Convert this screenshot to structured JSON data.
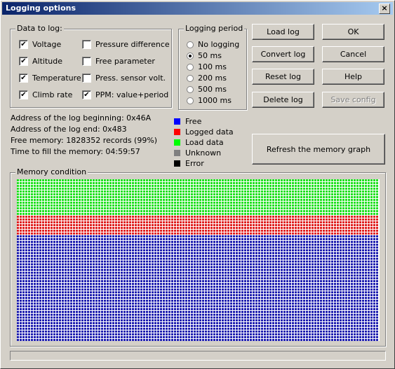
{
  "window": {
    "title": "Logging options",
    "close": "×"
  },
  "data_to_log": {
    "title": "Data to log:",
    "items": [
      {
        "label": "Voltage",
        "checked": true
      },
      {
        "label": "Altitude",
        "checked": true
      },
      {
        "label": "Temperature",
        "checked": true
      },
      {
        "label": "Climb rate",
        "checked": true
      },
      {
        "label": "Pressure difference",
        "checked": false
      },
      {
        "label": "Free parameter",
        "checked": false
      },
      {
        "label": "Press. sensor volt.",
        "checked": false
      },
      {
        "label": "PPM: value+period",
        "checked": true
      }
    ]
  },
  "logging_period": {
    "title": "Logging period",
    "options": [
      "No logging",
      "50 ms",
      "100 ms",
      "200 ms",
      "500 ms",
      "1000 ms"
    ],
    "selected": "50 ms"
  },
  "buttons": {
    "load_log": "Load log",
    "ok": "OK",
    "convert_log": "Convert log",
    "cancel": "Cancel",
    "reset_log": "Reset log",
    "help": "Help",
    "delete_log": "Delete log",
    "save_config": "Save config",
    "refresh": "Refresh the memory graph"
  },
  "info": {
    "log_begin": "Address of the log beginning: 0x46A",
    "log_end": "Address of the log end: 0x483",
    "free_memory": "Free memory: 1828352 records (99%)",
    "time_to_fill": "Time to fill the memory: 04:59:57"
  },
  "legend": [
    {
      "label": "Free",
      "color": "#0000ff"
    },
    {
      "label": "Logged data",
      "color": "#ff0000"
    },
    {
      "label": "Load data",
      "color": "#00ff00"
    },
    {
      "label": "Unknown",
      "color": "#808080"
    },
    {
      "label": "Error",
      "color": "#000000"
    }
  ],
  "memory": {
    "title": "Memory condition",
    "green_rows": 13,
    "red_rows": 7,
    "blue_rows": 38,
    "colors": {
      "free": "#2020b0",
      "logged": "#e02020",
      "load": "#20e020"
    }
  }
}
